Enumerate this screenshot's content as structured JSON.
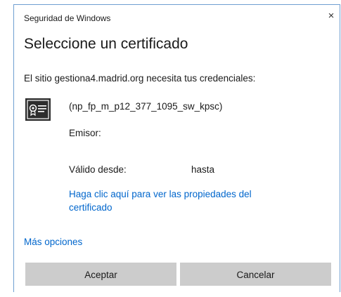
{
  "window": {
    "title": "Seguridad de Windows",
    "close_glyph": "×"
  },
  "dialog": {
    "heading": "Seleccione un certificado",
    "message": "El sitio gestiona4.madrid.org necesita tus credenciales:"
  },
  "certificate": {
    "icon": "certificate-icon",
    "name": "(np_fp_m_p12_377_1095_sw_kpsc)",
    "issuer_label": "Emisor:",
    "valid_from_label": "Válido desde:",
    "valid_to_label": "hasta",
    "properties_link": "Haga clic aquí para ver las propiedades del certificado"
  },
  "more_options": "Más opciones",
  "buttons": {
    "accept": "Aceptar",
    "cancel": "Cancelar"
  },
  "colors": {
    "link": "#0066cc",
    "button_bg": "#cccccc",
    "icon_bg": "#2d2d2d",
    "border": "#6f9fd1"
  }
}
